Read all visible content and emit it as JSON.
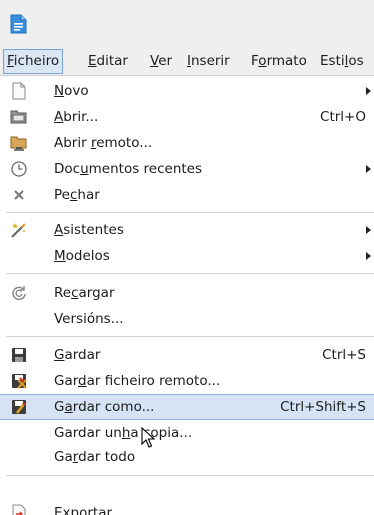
{
  "menubar": {
    "items": [
      {
        "pre": "",
        "acc": "F",
        "post": "icheiro",
        "active": true
      },
      {
        "pre": "",
        "acc": "E",
        "post": "ditar",
        "active": false
      },
      {
        "pre": "",
        "acc": "V",
        "post": "er",
        "active": false
      },
      {
        "pre": "",
        "acc": "I",
        "post": "nserir",
        "active": false
      },
      {
        "pre": "F",
        "acc": "o",
        "post": "rmato",
        "active": false
      },
      {
        "pre": "Esti",
        "acc": "l",
        "post": "os",
        "active": false
      }
    ]
  },
  "menu": {
    "items": [
      {
        "pre": "",
        "acc": "N",
        "post": "ovo",
        "shortcut": "",
        "submenu": true,
        "icon": "new-document-icon"
      },
      {
        "pre": "",
        "acc": "A",
        "post": "brir...",
        "shortcut": "Ctrl+O",
        "submenu": false,
        "icon": "open-folder-icon"
      },
      {
        "pre": "Abrir ",
        "acc": "r",
        "post": "emoto...",
        "shortcut": "",
        "submenu": false,
        "icon": "open-remote-icon"
      },
      {
        "pre": "Doc",
        "acc": "u",
        "post": "mentos recentes",
        "shortcut": "",
        "submenu": true,
        "icon": "recent-documents-icon"
      },
      {
        "pre": "Pe",
        "acc": "c",
        "post": "har",
        "shortcut": "",
        "submenu": false,
        "icon": "close-icon"
      },
      {
        "pre": "",
        "acc": "A",
        "post": "sistentes",
        "shortcut": "",
        "submenu": true,
        "icon": "wizard-icon"
      },
      {
        "pre": "",
        "acc": "M",
        "post": "odelos",
        "shortcut": "",
        "submenu": true,
        "icon": ""
      },
      {
        "pre": "Re",
        "acc": "c",
        "post": "argar",
        "shortcut": "",
        "submenu": false,
        "icon": "reload-icon"
      },
      {
        "pre": "Versións...",
        "acc": "",
        "post": "",
        "shortcut": "",
        "submenu": false,
        "icon": ""
      },
      {
        "pre": "",
        "acc": "G",
        "post": "ardar",
        "shortcut": "Ctrl+S",
        "submenu": false,
        "icon": "save-icon"
      },
      {
        "pre": "Gar",
        "acc": "d",
        "post": "ar ficheiro remoto...",
        "shortcut": "",
        "submenu": false,
        "icon": "save-remote-icon"
      },
      {
        "pre": "G",
        "acc": "a",
        "post": "rdar como...",
        "shortcut": "Ctrl+Shift+S",
        "submenu": false,
        "icon": "save-as-icon"
      },
      {
        "pre": "Gardar un",
        "acc": "h",
        "post": "a copia...",
        "shortcut": "",
        "submenu": false,
        "icon": ""
      },
      {
        "pre": "Ga",
        "acc": "r",
        "post": "dar todo",
        "shortcut": "",
        "submenu": false,
        "icon": ""
      },
      {
        "pre": "E",
        "acc": "x",
        "post": "portar",
        "shortcut": "",
        "submenu": false,
        "icon": "export-icon"
      }
    ]
  }
}
